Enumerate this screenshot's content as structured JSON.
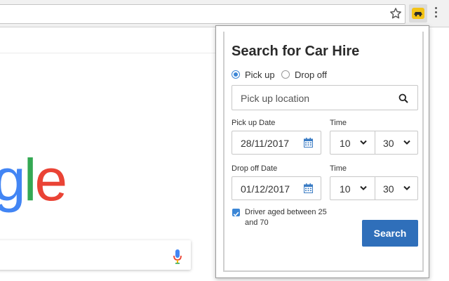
{
  "browser": {
    "extension_icon": "car-icon",
    "star_icon": "star-icon",
    "menu_icon": "more-vert-icon"
  },
  "page": {
    "logo_partial": "gle",
    "mic_icon": "microphone-icon"
  },
  "popup": {
    "title": "Search for Car Hire",
    "radios": [
      {
        "label": "Pick up",
        "checked": true
      },
      {
        "label": "Drop off",
        "checked": false
      }
    ],
    "location": {
      "placeholder": "Pick up location",
      "icon": "search-icon"
    },
    "pickup": {
      "date_label": "Pick up Date",
      "date": "28/11/2017",
      "time_label": "Time",
      "hour": "10",
      "minute": "30"
    },
    "dropoff": {
      "date_label": "Drop off Date",
      "date": "01/12/2017",
      "time_label": "Time",
      "hour": "10",
      "minute": "30"
    },
    "driver_age": {
      "checked": true,
      "label": "Driver aged between 25 and 70"
    },
    "search_button": "Search"
  },
  "colors": {
    "accent": "#2f6fba",
    "radio_accent": "#3b86d6",
    "ext_yellow": "#f3c316"
  }
}
